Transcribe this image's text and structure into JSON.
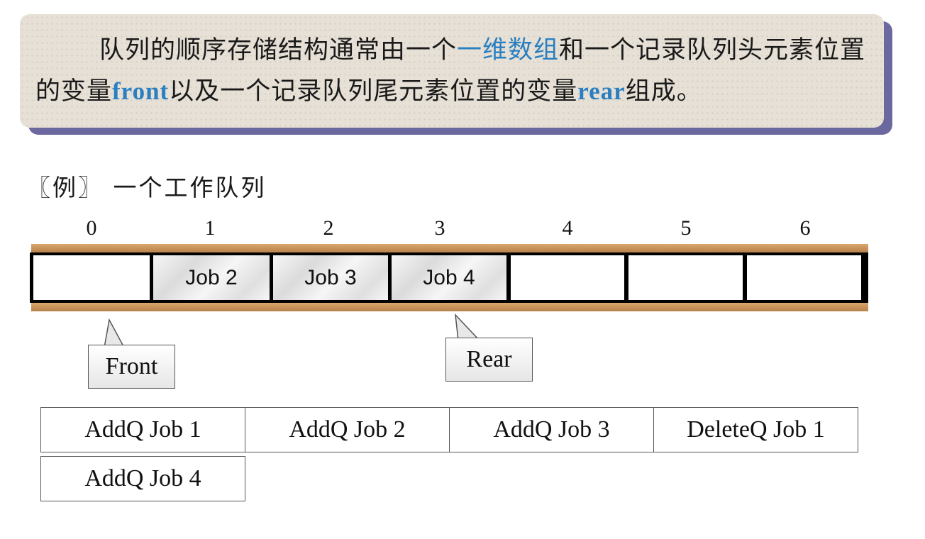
{
  "intro": {
    "part1": "队列的顺序存储结构通常由一个",
    "hl1": "一维数组",
    "part2": "和一个记录队列头元素位置的变量",
    "hl2": "front",
    "part3": "以及一个记录队列尾元素位置的变量",
    "hl3": "rear",
    "part4": "组成。"
  },
  "example_title": "〖例〗 一个工作队列",
  "queue": {
    "indices": [
      "0",
      "1",
      "2",
      "3",
      "4",
      "5",
      "6"
    ],
    "cells": [
      "",
      "Job 2",
      "Job 3",
      "Job 4",
      "",
      "",
      ""
    ],
    "filled": [
      false,
      true,
      true,
      true,
      false,
      false,
      false
    ],
    "front_label": "Front",
    "front_index": 0,
    "rear_label": "Rear",
    "rear_index": 3
  },
  "operations": [
    "AddQ Job 1",
    "AddQ Job 2",
    "AddQ Job 3",
    "DeleteQ Job 1",
    "AddQ Job 4"
  ],
  "colors": {
    "highlight": "#2a7fc1",
    "box_bg": "#e6e0d6",
    "box_shadow": "#6b68a0",
    "rail": "#c99a62"
  }
}
